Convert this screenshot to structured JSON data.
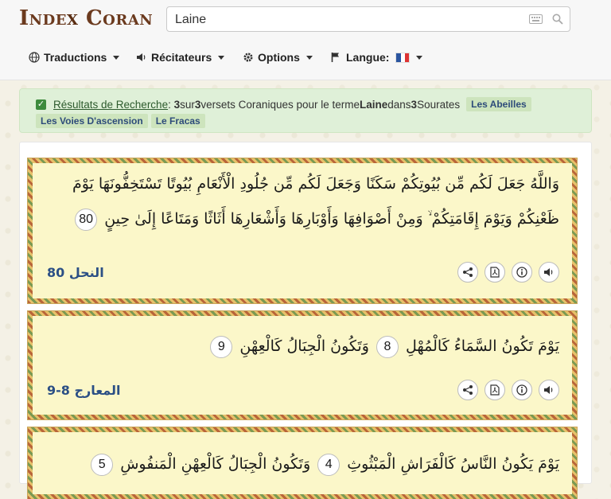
{
  "logo": {
    "part1": "Inde",
    "x": "x",
    "part2": "Coran"
  },
  "search": {
    "value": "Laine",
    "placeholder": ""
  },
  "nav": {
    "translations": "Traductions",
    "reciters": "Récitateurs",
    "options": "Options",
    "language": "Langue:"
  },
  "results": {
    "link": "Résultats de Recherche",
    "colon": ": ",
    "count": "3",
    "sur": " sur ",
    "total": "3",
    "mid": " versets Coraniques pour le terme ",
    "term": "Laine",
    "dans": " dans ",
    "sourates_count": "3",
    "sourates_label": " Sourates",
    "tags": [
      "Les Abeilles",
      "Les Voies D'ascension",
      "Le Fracas"
    ]
  },
  "verses": [
    {
      "text_a": "وَاللَّهُ جَعَلَ لَكُم مِّن بُيُوتِكُمْ سَكَنًا وَجَعَلَ لَكُم مِّن جُلُودِ الْأَنْعَامِ بُيُوتًا تَسْتَخِفُّونَهَا يَوْمَ",
      "text_b": "ظَعْنِكُمْ وَيَوْمَ إِقَامَتِكُمْ ۙ وَمِنْ أَصْوَافِهَا وَأَوْبَارِهَا وَأَشْعَارِهَا أَثَاثًا وَمَتَاعًا إِلَىٰ حِينٍ",
      "num": "80",
      "ref": "النحل 80"
    },
    {
      "part1": "يَوْمَ تَكُونُ السَّمَاءُ كَالْمُهْلِ",
      "num1": "8",
      "part2": "وَتَكُونُ الْجِبَالُ كَالْعِهْنِ",
      "num2": "9",
      "ref": "المعارج 8-9"
    },
    {
      "part1": "يَوْمَ يَكُونُ النَّاسُ كَالْفَرَاشِ الْمَبْثُوثِ",
      "num1": "4",
      "part2": "وَتَكُونُ الْجِبَالُ كَالْعِهْنِ الْمَنفُوشِ",
      "num2": "5"
    }
  ],
  "colors": {
    "accent": "#2b4f85",
    "success_bg": "#dff0d8",
    "verse_bg": "#fbf7c9"
  }
}
